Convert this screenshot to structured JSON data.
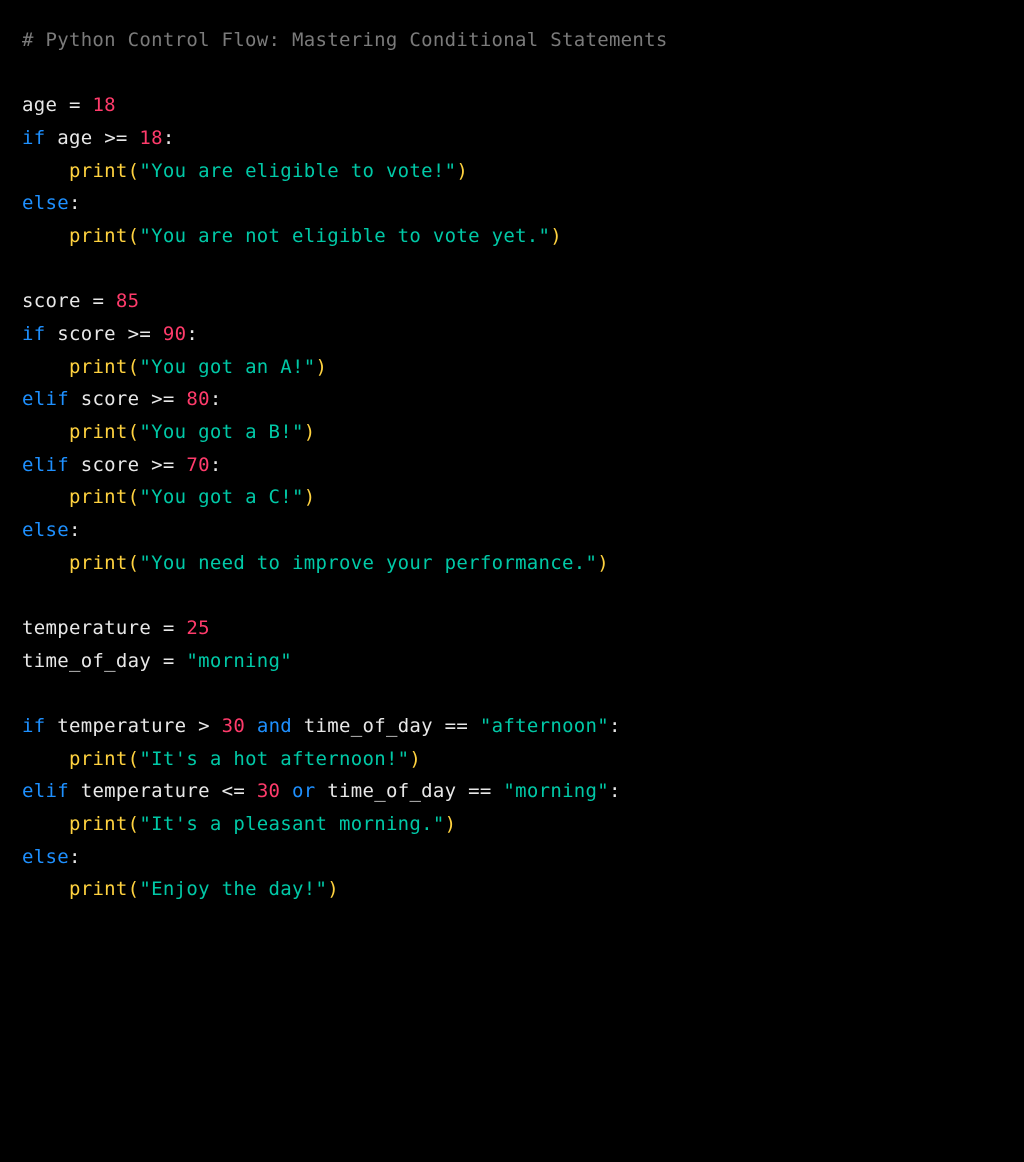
{
  "colors": {
    "bg": "#000000",
    "default": "#e8e8e8",
    "comment": "#7b7b7b",
    "keyword": "#1e90ff",
    "function": "#ffd23f",
    "string": "#00c9a7",
    "number": "#ff3b6b"
  },
  "comment": "# Python Control Flow: Mastering Conditional Statements",
  "code": {
    "l01_var": "age",
    "l01_eq": " = ",
    "l01_val": "18",
    "l02_if": "if",
    "l02_cond_a": " age ",
    "l02_cond_op": ">=",
    "l02_sp": " ",
    "l02_cond_b": "18",
    "l02_colon": ":",
    "l03_indent": "    ",
    "l03_fn": "print",
    "l03_lp": "(",
    "l03_str": "\"You are eligible to vote!\"",
    "l03_rp": ")",
    "l04_else": "else",
    "l04_colon": ":",
    "l05_indent": "    ",
    "l05_fn": "print",
    "l05_lp": "(",
    "l05_str": "\"You are not eligible to vote yet.\"",
    "l05_rp": ")",
    "l07_var": "score",
    "l07_eq": " = ",
    "l07_val": "85",
    "l08_if": "if",
    "l08_a": " score ",
    "l08_op": ">=",
    "l08_sp": " ",
    "l08_b": "90",
    "l08_colon": ":",
    "l09_indent": "    ",
    "l09_fn": "print",
    "l09_lp": "(",
    "l09_str": "\"You got an A!\"",
    "l09_rp": ")",
    "l10_elif": "elif",
    "l10_a": " score ",
    "l10_op": ">=",
    "l10_sp": " ",
    "l10_b": "80",
    "l10_colon": ":",
    "l11_indent": "    ",
    "l11_fn": "print",
    "l11_lp": "(",
    "l11_str": "\"You got a B!\"",
    "l11_rp": ")",
    "l12_elif": "elif",
    "l12_a": " score ",
    "l12_op": ">=",
    "l12_sp": " ",
    "l12_b": "70",
    "l12_colon": ":",
    "l13_indent": "    ",
    "l13_fn": "print",
    "l13_lp": "(",
    "l13_str": "\"You got a C!\"",
    "l13_rp": ")",
    "l14_else": "else",
    "l14_colon": ":",
    "l15_indent": "    ",
    "l15_fn": "print",
    "l15_lp": "(",
    "l15_str": "\"You need to improve your performance.\"",
    "l15_rp": ")",
    "l17_var": "temperature",
    "l17_eq": " = ",
    "l17_val": "25",
    "l18_var": "time_of_day",
    "l18_eq": " = ",
    "l18_val": "\"morning\"",
    "l20_if": "if",
    "l20_a": " temperature ",
    "l20_op1": ">",
    "l20_sp1": " ",
    "l20_b": "30",
    "l20_sp2": " ",
    "l20_and": "and",
    "l20_c": " time_of_day ",
    "l20_op2": "==",
    "l20_sp3": " ",
    "l20_d": "\"afternoon\"",
    "l20_colon": ":",
    "l21_indent": "    ",
    "l21_fn": "print",
    "l21_lp": "(",
    "l21_str": "\"It's a hot afternoon!\"",
    "l21_rp": ")",
    "l22_elif": "elif",
    "l22_a": " temperature ",
    "l22_op1": "<=",
    "l22_sp1": " ",
    "l22_b": "30",
    "l22_sp2": " ",
    "l22_or": "or",
    "l22_c": " time_of_day ",
    "l22_op2": "==",
    "l22_sp3": " ",
    "l22_d": "\"morning\"",
    "l22_colon": ":",
    "l23_indent": "    ",
    "l23_fn": "print",
    "l23_lp": "(",
    "l23_str": "\"It's a pleasant morning.\"",
    "l23_rp": ")",
    "l24_else": "else",
    "l24_colon": ":",
    "l25_indent": "    ",
    "l25_fn": "print",
    "l25_lp": "(",
    "l25_str": "\"Enjoy the day!\"",
    "l25_rp": ")"
  }
}
